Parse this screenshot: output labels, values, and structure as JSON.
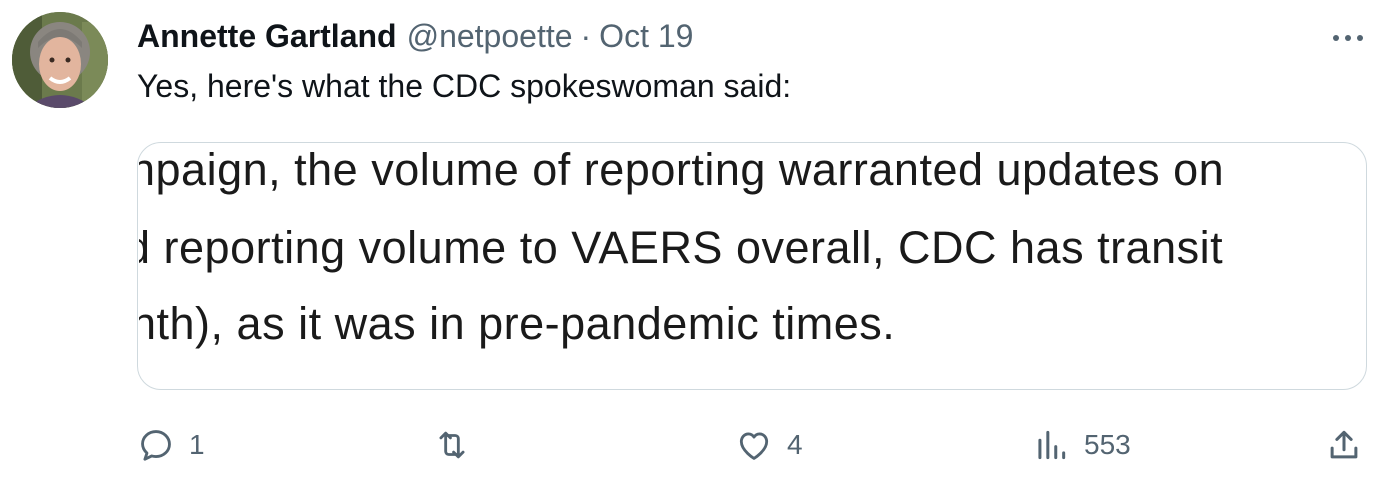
{
  "tweet": {
    "author_name": "Annette Gartland",
    "handle": "@netpoette",
    "separator": "·",
    "date": "Oct 19",
    "text": "Yes, here's what the CDC spokeswoman said:",
    "media_lines": [
      "npaign, the volume of reporting warranted updates on",
      "d reporting volume to VAERS overall, CDC has transit",
      "nth), as it was in pre-pandemic times."
    ]
  },
  "actions": {
    "reply_count": "1",
    "retweet_count": "",
    "like_count": "4",
    "views_count": "553"
  },
  "icons": {
    "more": "more-icon",
    "reply": "reply-icon",
    "retweet": "retweet-icon",
    "like": "heart-icon",
    "views": "views-icon",
    "share": "share-icon"
  },
  "colors": {
    "text": "#0f1419",
    "secondary": "#536471",
    "border": "#cfd9de"
  }
}
